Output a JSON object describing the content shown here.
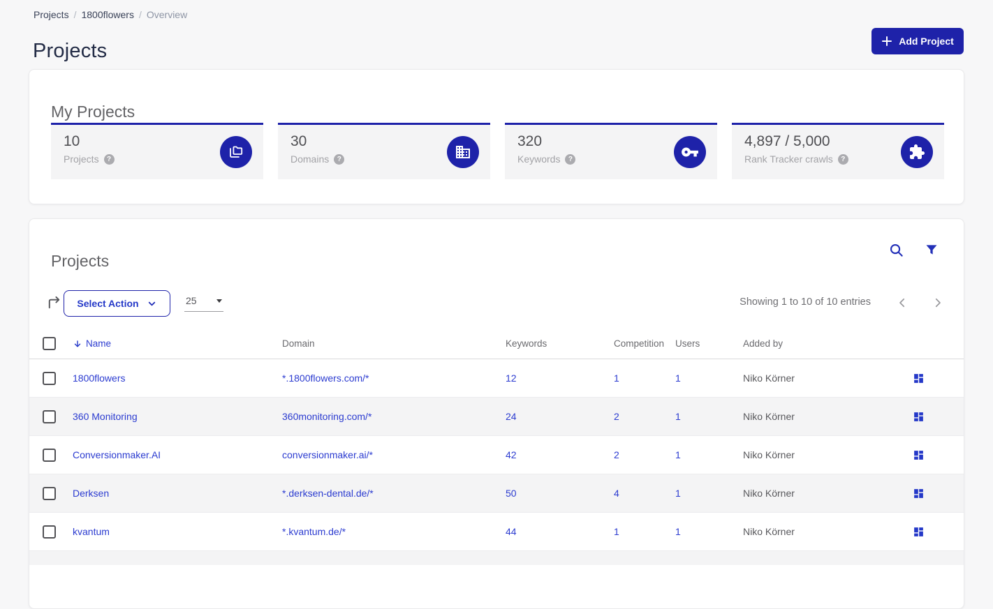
{
  "colors": {
    "primary": "#1e22a9",
    "link": "#2b3bd0"
  },
  "breadcrumb": {
    "separator": "/",
    "items": [
      {
        "label": "Projects"
      },
      {
        "label": "1800flowers"
      },
      {
        "label": "Overview"
      }
    ]
  },
  "page": {
    "title": "Projects"
  },
  "header": {
    "add_project_label": "Add Project"
  },
  "stats_card": {
    "title": "My Projects",
    "stats": [
      {
        "value": "10",
        "label": "Projects",
        "icon": "projects-folders-icon"
      },
      {
        "value": "30",
        "label": "Domains",
        "icon": "domains-building-icon"
      },
      {
        "value": "320",
        "label": "Keywords",
        "icon": "keywords-key-icon"
      },
      {
        "value": "4,897 / 5,000",
        "label": "Rank Tracker crawls",
        "icon": "crawls-puzzle-icon"
      }
    ],
    "help_glyph": "?"
  },
  "table_card": {
    "title": "Projects",
    "toolbar": {
      "select_action_label": "Select Action",
      "page_size_value": "25",
      "showing_text": "Showing 1 to 10 of 10 entries"
    },
    "columns": {
      "name": "Name",
      "domain": "Domain",
      "keywords": "Keywords",
      "competition": "Competition",
      "users": "Users",
      "added_by": "Added by"
    },
    "sort": {
      "column": "Name",
      "direction": "desc"
    },
    "rows": [
      {
        "name": "1800flowers",
        "domain": "*.1800flowers.com/*",
        "keywords": "12",
        "competition": "1",
        "users": "1",
        "added_by": "Niko Körner"
      },
      {
        "name": "360 Monitoring",
        "domain": "360monitoring.com/*",
        "keywords": "24",
        "competition": "2",
        "users": "1",
        "added_by": "Niko Körner"
      },
      {
        "name": "Conversionmaker.AI",
        "domain": "conversionmaker.ai/*",
        "keywords": "42",
        "competition": "2",
        "users": "1",
        "added_by": "Niko Körner"
      },
      {
        "name": "Derksen",
        "domain": "*.derksen-dental.de/*",
        "keywords": "50",
        "competition": "4",
        "users": "1",
        "added_by": "Niko Körner"
      },
      {
        "name": "kvantum",
        "domain": "*.kvantum.de/*",
        "keywords": "44",
        "competition": "1",
        "users": "1",
        "added_by": "Niko Körner"
      }
    ]
  }
}
